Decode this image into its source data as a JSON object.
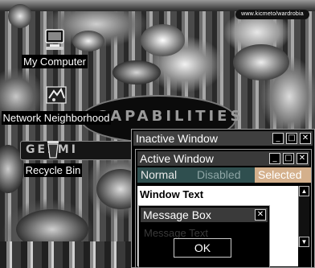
{
  "banner": {
    "text": "www.kicmeto/wardrobia"
  },
  "wallpaper": {
    "logo_text": "CAPABILITIES",
    "strip_text": "GE2MI"
  },
  "desktop_icons": [
    {
      "label": "My Computer",
      "icon": "computer-icon"
    },
    {
      "label": "Network Neighborhood",
      "icon": "network-icon"
    },
    {
      "label": "Recycle Bin",
      "icon": "recycle-bin-icon"
    }
  ],
  "inactive_window": {
    "title": "Inactive Window",
    "title_bg": "#3f3f3f"
  },
  "active_window": {
    "title": "Active Window",
    "title_bg": "#3a3a3a"
  },
  "menu": {
    "normal": "Normal",
    "disabled": "Disabled",
    "selected": "Selected",
    "menu_bg": "#2f4f4f",
    "selected_bg": "#d4b08c",
    "disabled_color": "#8fa6a6"
  },
  "window_text": "Window Text",
  "message_box": {
    "title": "Message Box",
    "body": "Message Text",
    "ok": "OK"
  },
  "glyphs": {
    "minimize": "_",
    "maximize": "□",
    "close": "✕",
    "up": "▲",
    "down": "▼"
  }
}
